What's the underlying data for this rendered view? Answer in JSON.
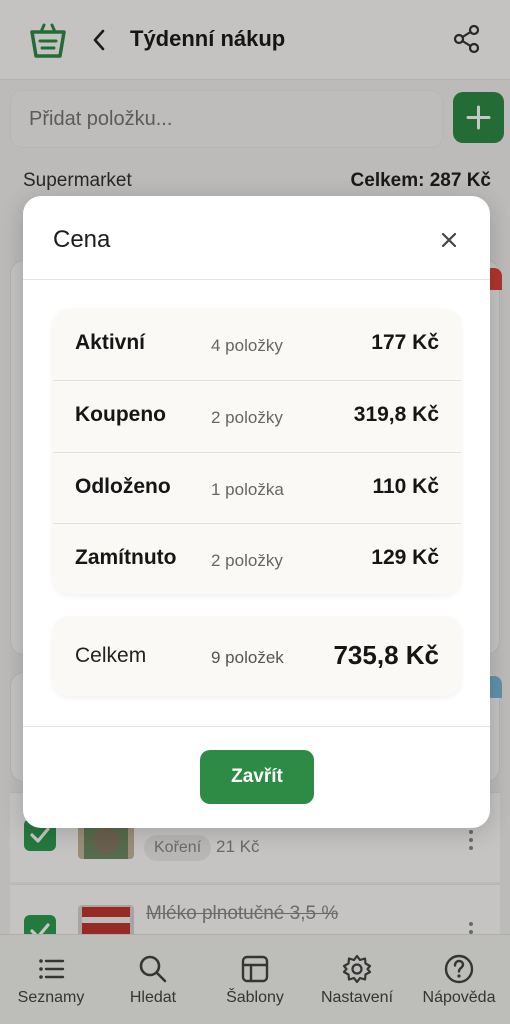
{
  "header": {
    "title": "Týdenní nákup",
    "logo_icon": "basket-icon",
    "back_icon": "chevron-left-icon",
    "share_icon": "share-icon"
  },
  "add_item": {
    "placeholder": "Přidat položku...",
    "button_icon": "plus-icon"
  },
  "store": {
    "name": "Supermarket",
    "total": "Celkem: 287 Kč"
  },
  "list_items": [
    {
      "chip": "Koření",
      "price": "21 Kč"
    },
    {
      "name": "Mléko plnotučné 3,5 %"
    }
  ],
  "modal": {
    "title": "Cena",
    "rows": [
      {
        "label": "Aktivní",
        "count": "4 položky",
        "value": "177 Kč"
      },
      {
        "label": "Koupeno",
        "count": "2 položky",
        "value": "319,8 Kč"
      },
      {
        "label": "Odloženo",
        "count": "1 položka",
        "value": "110 Kč"
      },
      {
        "label": "Zamítnuto",
        "count": "2 položky",
        "value": "129 Kč"
      }
    ],
    "total": {
      "label": "Celkem",
      "count": "9 položek",
      "value": "735,8 Kč"
    },
    "close_label": "Zavřít"
  },
  "nav": [
    {
      "label": "Seznamy",
      "icon": "list-icon"
    },
    {
      "label": "Hledat",
      "icon": "search-icon"
    },
    {
      "label": "Šablony",
      "icon": "template-icon"
    },
    {
      "label": "Nastavení",
      "icon": "gear-icon"
    },
    {
      "label": "Nápověda",
      "icon": "help-icon"
    }
  ],
  "colors": {
    "primary": "#2e8b46",
    "checkbox": "#2f9c4f",
    "accent_red": "#e0453a",
    "accent_blue": "#7db9dd"
  }
}
